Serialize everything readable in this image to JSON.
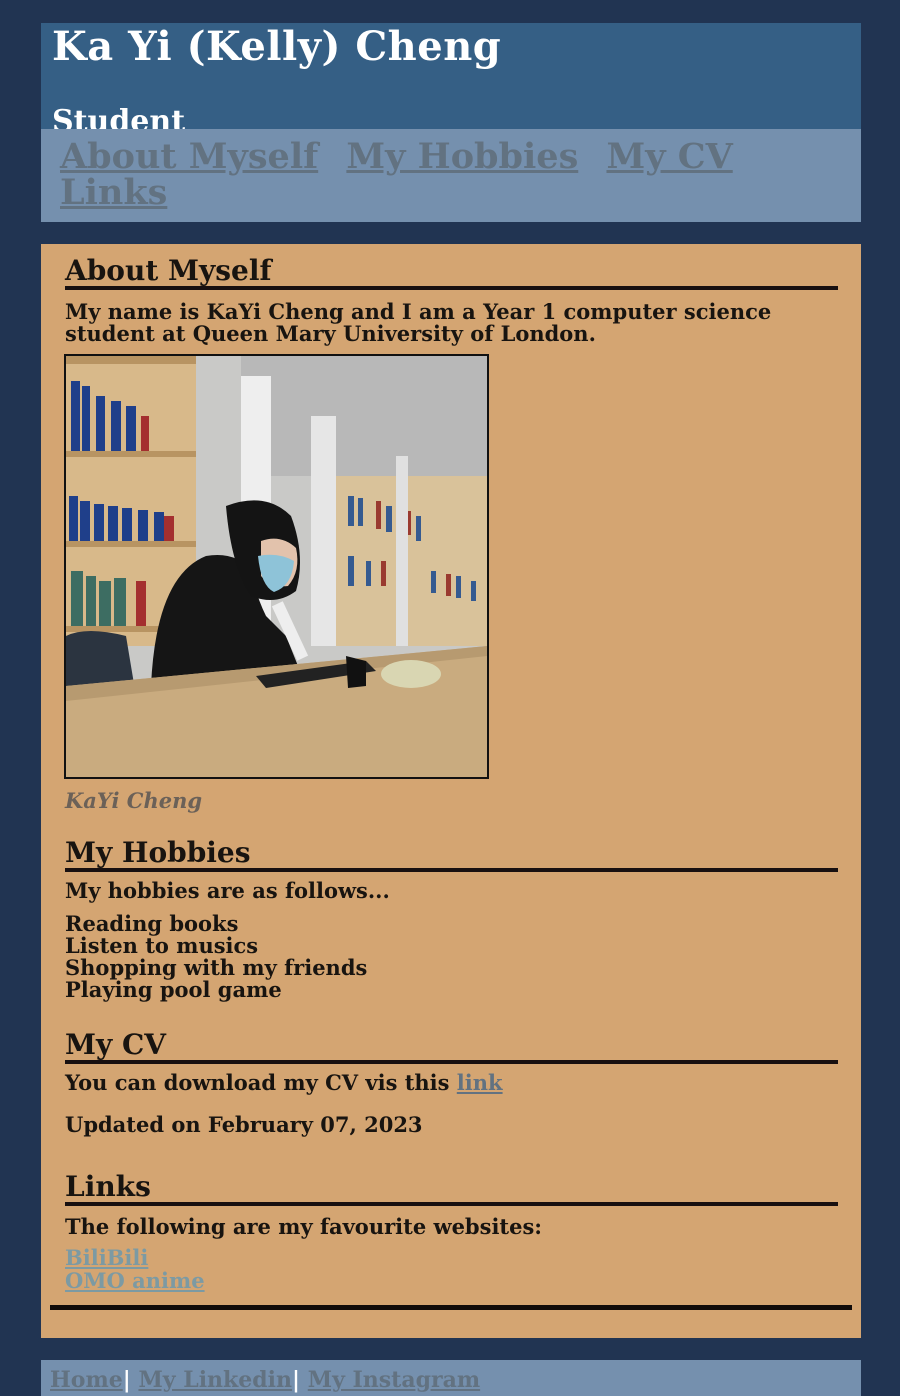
{
  "header": {
    "title": "Ka Yi (Kelly) Cheng",
    "subtitle": "Student"
  },
  "nav": {
    "items": [
      {
        "label": "About Myself"
      },
      {
        "label": "My Hobbies"
      },
      {
        "label": "My CV"
      },
      {
        "label": "Links"
      }
    ]
  },
  "about": {
    "heading": "About Myself",
    "text": "My name is KaYi Cheng and I am a Year 1 computer science student at Queen Mary University of London.",
    "caption": "KaYi Cheng"
  },
  "hobbies": {
    "heading": "My Hobbies",
    "intro": "My hobbies are as follows...",
    "items": [
      "Reading books",
      "Listen to musics",
      "Shopping with my friends",
      "Playing pool game"
    ]
  },
  "cv": {
    "heading": "My CV",
    "text": "You can download my CV vis this",
    "link_label": "link",
    "updated": "Updated on February 07, 2023"
  },
  "links": {
    "heading": "Links",
    "intro": "The following are my favourite websites:",
    "items": [
      "BiliBili",
      "OMO anime"
    ]
  },
  "footer": {
    "items": [
      "Home",
      "My Linkedin",
      "My Instagram"
    ],
    "separator": "|"
  },
  "colors": {
    "page_bg": "#213452",
    "header_bg": "#355f85",
    "nav_bg": "#7590ae",
    "content_bg": "#d4a572",
    "link": "#627281",
    "fav_link": "#7c9aa3"
  }
}
